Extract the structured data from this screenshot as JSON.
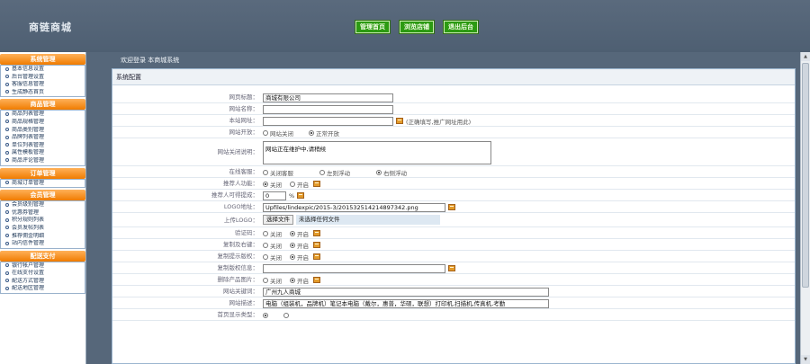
{
  "header": {
    "logo": "商链商城",
    "nav": [
      "管理首页",
      "浏览店铺",
      "退出后台"
    ]
  },
  "sidebar": {
    "sections": [
      {
        "title": "系统管理",
        "items": [
          "基本信息设置",
          "后台管理设置",
          "客服信息管理",
          "生成静态首页"
        ]
      },
      {
        "title": "商品管理",
        "items": [
          "商品列表管理",
          "商品规格管理",
          "商品类别管理",
          "品牌列表管理",
          "单位列表管理",
          "属性模板管理",
          "商品评论管理"
        ]
      },
      {
        "title": "订单管理",
        "items": [
          "商城订单管理"
        ]
      },
      {
        "title": "会员管理",
        "items": [
          "会员级别管理",
          "优惠券管理",
          "积分规则列表",
          "会员发帖列表",
          "推荐佣金明细",
          "站内信件管理"
        ]
      },
      {
        "title": "配送支付",
        "items": [
          "银行帐户管理",
          "在线支付设置",
          "配送方式管理",
          "配送地区管理"
        ]
      }
    ]
  },
  "main": {
    "welcome": "欢迎登录 本商城系统",
    "panel_title": "系统配置",
    "form": {
      "site_title_label": "网页标题：",
      "site_title_value": "商城有限公司",
      "site_name_label": "网站名称：",
      "site_url_label": "本站网址：",
      "site_url_hint": "(正确填写,推广网址用此)",
      "site_open_label": "网站开放：",
      "site_open_opts": [
        "网站关闭",
        "正常开放"
      ],
      "close_reason_label": "网站关闭说明：",
      "close_reason_value": "网站正在维护中,请稍候",
      "service_label": "在线客服：",
      "service_opts": [
        "关闭客服",
        "左则浮动",
        "右侧浮动"
      ],
      "recommend_label": "推荐人功能：",
      "recommend_opts": [
        "关闭",
        "开启"
      ],
      "commission_label": "推荐人可得提成：",
      "commission_value": "0",
      "commission_unit": "%",
      "logo_url_label": "LOGO地址：",
      "logo_url_value": "Upfiles/lindexpic/2015-3/201532514214897342.png",
      "upload_logo_label": "上传LOGO：",
      "choose_file": "选择文件",
      "no_file": "未选择任何文件",
      "captcha_label": "验证码：",
      "captcha_opts": [
        "关闭",
        "开启"
      ],
      "copy_label": "复制及右键：",
      "copy_opts": [
        "关闭",
        "开启"
      ],
      "copyright_tip_label": "复制提示版权：",
      "copyright_tip_opts": [
        "关闭",
        "开启"
      ],
      "copyright_info_label": "复制版权信息：",
      "delete_img_label": "删除产品图片：",
      "delete_img_opts": [
        "关闭",
        "开启"
      ],
      "keywords_label": "网站关键词：",
      "keywords_value": "广州九人商城",
      "description_label": "网站描述：",
      "description_value": "电脑（组装机，品牌机）笔记本电脑（戴尔，惠普，华硕，联想）打印机,扫描机,传真机,考勤",
      "homepage_label": "首页显示类型："
    }
  },
  "colors": {
    "header_bg": "#56677a",
    "nav_button": "#2c9a12",
    "section_head": "#f07c00",
    "pencil_icon": "#e39b2a"
  }
}
